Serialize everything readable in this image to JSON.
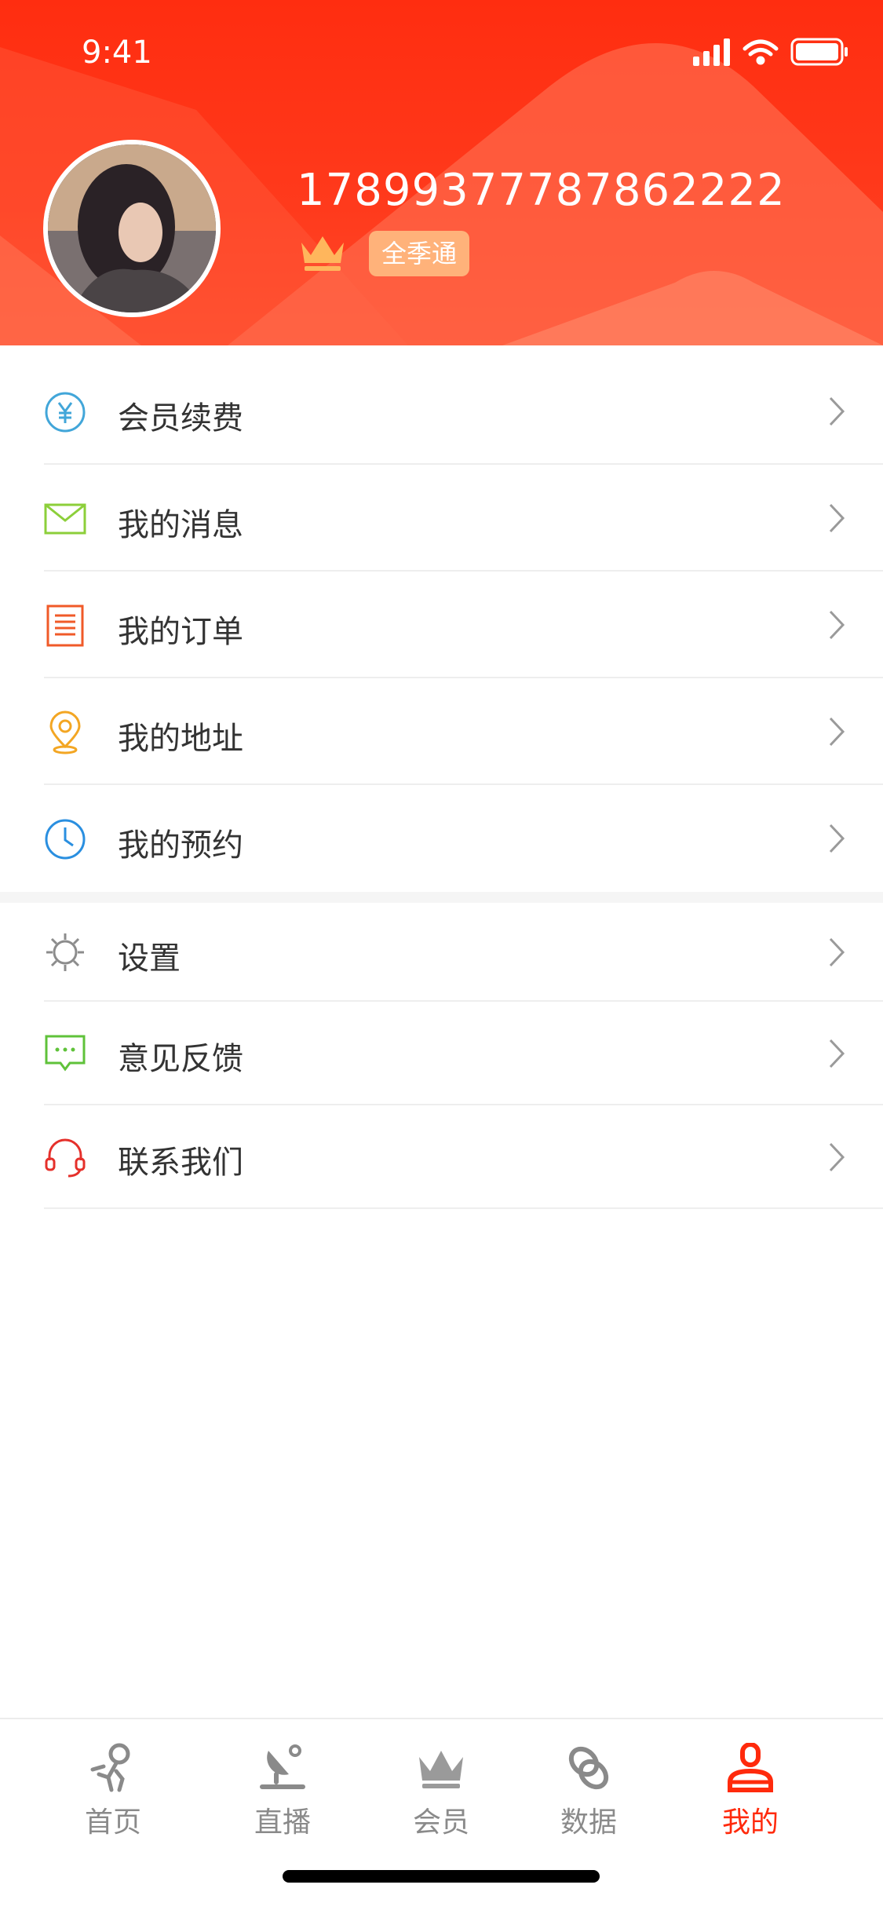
{
  "status_bar": {
    "time": "9:41"
  },
  "profile": {
    "user_id": "17899377787862222",
    "badge": "全季通"
  },
  "menu_group_1": [
    {
      "label": "会员续费",
      "icon": "renew-yen-icon",
      "color": "#42a6d9"
    },
    {
      "label": "我的消息",
      "icon": "mail-icon",
      "color": "#8ccf3a"
    },
    {
      "label": "我的订单",
      "icon": "order-icon",
      "color": "#f05a28"
    },
    {
      "label": "我的地址",
      "icon": "location-pin-icon",
      "color": "#f3a623"
    },
    {
      "label": "我的预约",
      "icon": "clock-icon",
      "color": "#2a8fe0"
    }
  ],
  "menu_group_2": [
    {
      "label": "设置",
      "icon": "gear-icon",
      "color": "#8c8c8c"
    },
    {
      "label": "意见反馈",
      "icon": "feedback-icon",
      "color": "#5fc23a"
    },
    {
      "label": "联系我们",
      "icon": "headset-icon",
      "color": "#e5302b"
    }
  ],
  "tabs": [
    {
      "label": "首页",
      "icon": "home-run-icon"
    },
    {
      "label": "直播",
      "icon": "live-satellite-icon"
    },
    {
      "label": "会员",
      "icon": "crown-icon"
    },
    {
      "label": "数据",
      "icon": "data-rings-icon"
    },
    {
      "label": "我的",
      "icon": "user-icon",
      "active": true
    }
  ],
  "colors": {
    "brand_red": "#ff2d10",
    "badge_orange": "#ffb27a",
    "active_tab": "#ff2a0c"
  }
}
